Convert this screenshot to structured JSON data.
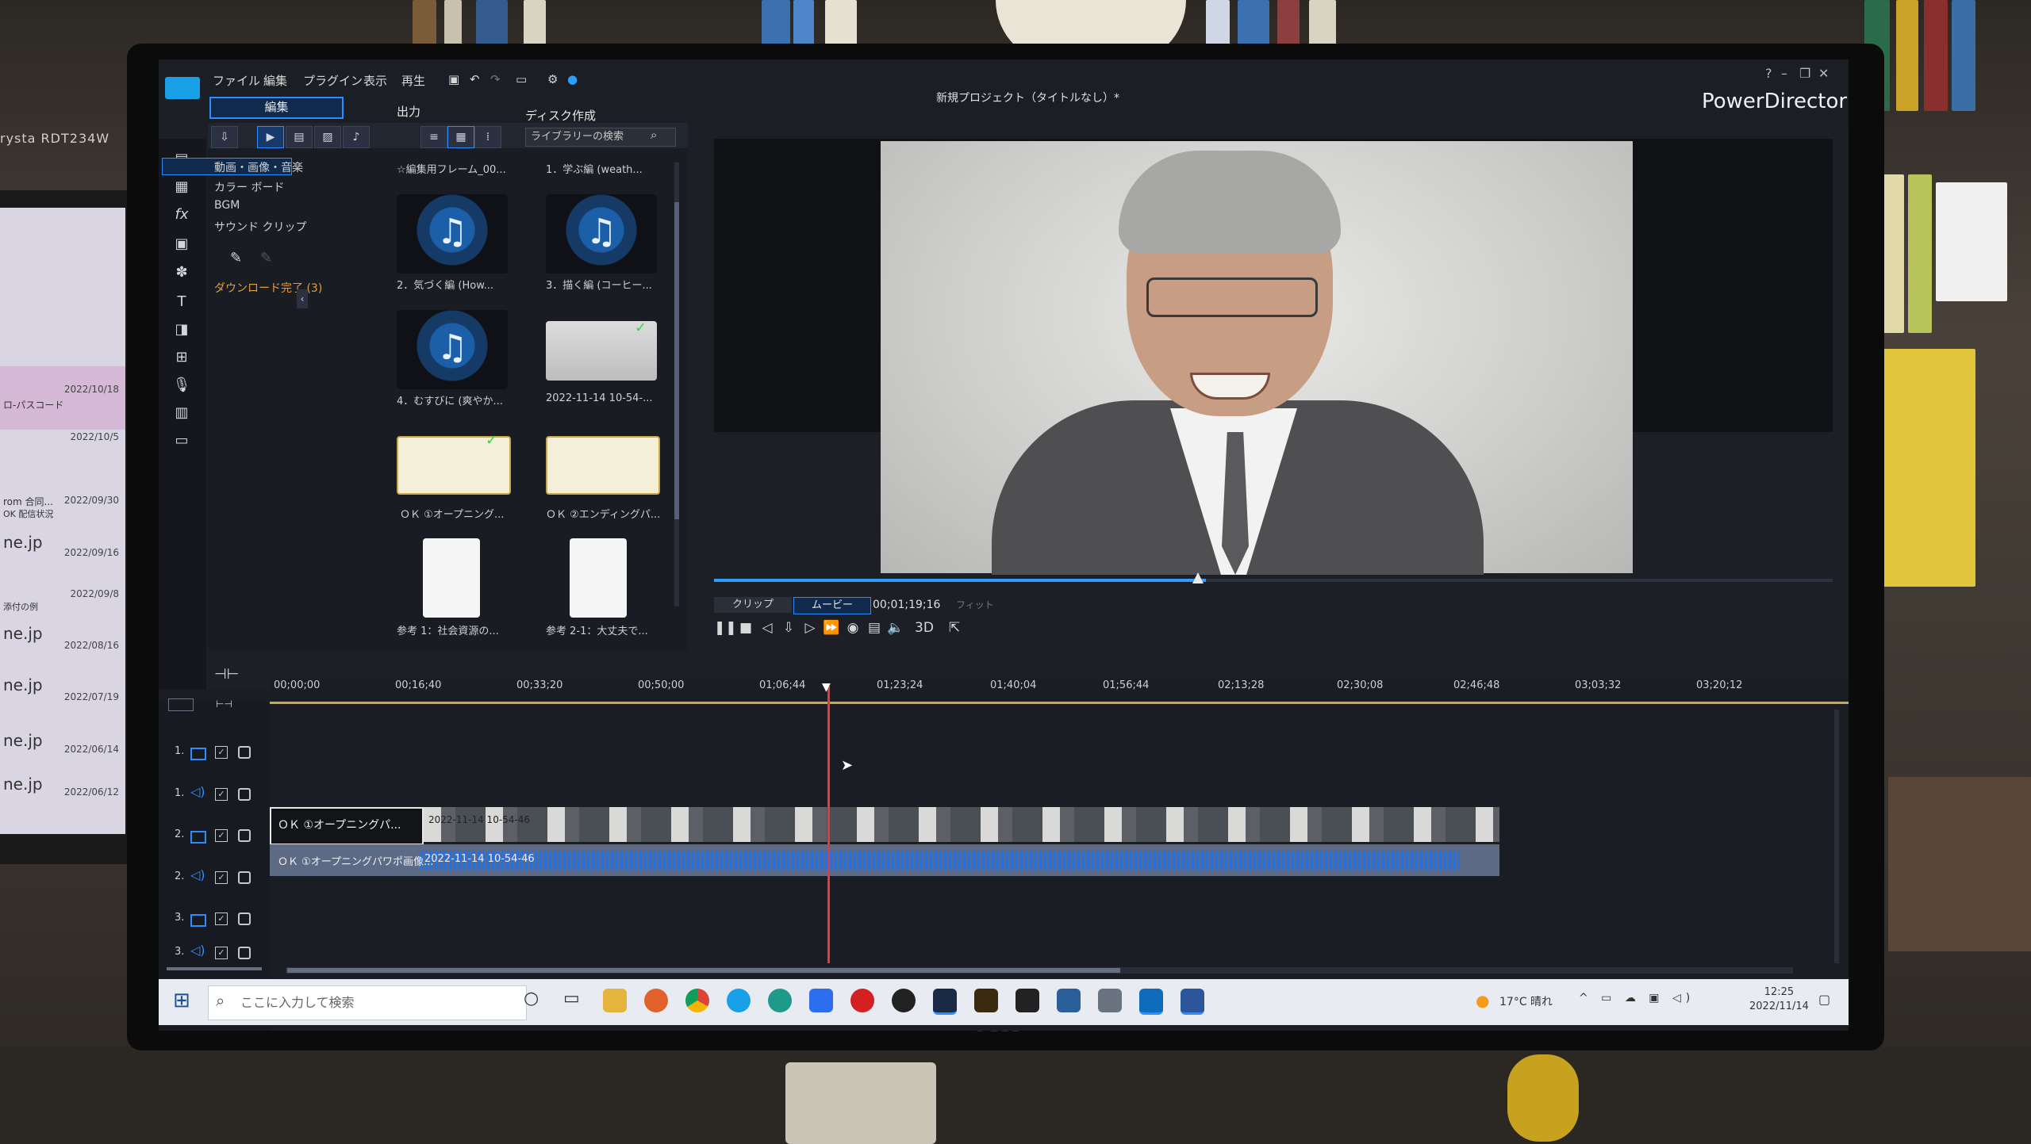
{
  "left_monitor": {
    "brand_label": "rysta RDT234W",
    "items": [
      {
        "text": "2022/10/18"
      },
      {
        "text": "ロ-パスコード"
      },
      {
        "text": "2022/10/5"
      },
      {
        "text": "rom 合同..."
      },
      {
        "text": "2022/09/30"
      },
      {
        "text": "OK 配信状況"
      },
      {
        "text": "ne.jp"
      },
      {
        "text": "2022/09/16"
      },
      {
        "text": "2022/09/8"
      },
      {
        "text": "添付の例"
      },
      {
        "text": "ne.jp"
      },
      {
        "text": "2022/08/16"
      },
      {
        "text": "ne.jp"
      },
      {
        "text": "2022/07/19"
      },
      {
        "text": "ne.jp"
      },
      {
        "text": "2022/06/14"
      },
      {
        "text": "ne.jp"
      },
      {
        "text": "2022/06/12"
      }
    ]
  },
  "app": {
    "menu": [
      "ファイル",
      "編集",
      "プラグイン",
      "表示",
      "再生"
    ],
    "tabs": [
      "編集",
      "出力",
      "ディスク作成"
    ],
    "project_title": "新規プロジェクト（タイトルなし）*",
    "brand": "PowerDirector",
    "search_placeholder": "ライブラリーの検索"
  },
  "library_tree": {
    "items": [
      "動画・画像・音楽",
      "カラー ボード",
      "BGM",
      "サウンド クリップ"
    ],
    "download": "ダウンロード完了 (3)"
  },
  "library_items": [
    {
      "label": "☆編集用フレーム_00...",
      "kind": "header"
    },
    {
      "label": "1．学ぶ編 (weath...",
      "kind": "header"
    },
    {
      "label": "2．気づく編 (How...",
      "kind": "audio"
    },
    {
      "label": "3．描く編 (コーヒー...",
      "kind": "audio"
    },
    {
      "label": "4．むすびに (爽やか...",
      "kind": "audio"
    },
    {
      "label": "2022-11-14 10-54-...",
      "kind": "photo"
    },
    {
      "label": "ＯＫ ①オープニング...",
      "kind": "slide"
    },
    {
      "label": "ＯＫ ②エンディングパ...",
      "kind": "slide"
    },
    {
      "label": "参考 1：社会資源の...",
      "kind": "doc"
    },
    {
      "label": "参考 2-1：大丈夫で...",
      "kind": "doc"
    }
  ],
  "preview": {
    "clip_label": "クリップ",
    "movie_label": "ムービー",
    "timecode": "00;01;19;16",
    "fit_label": "フィット",
    "mode_3d": "3D",
    "progress": 0.44
  },
  "timeline": {
    "ruler": [
      "00;00;00",
      "00;16;40",
      "00;33;20",
      "00;50;00",
      "01;06;44",
      "01;23;24",
      "01;40;04",
      "01;56;44",
      "02;13;28",
      "02;30;08",
      "02;46;48",
      "03;03;32",
      "03;20;12"
    ],
    "tracks": [
      "1.",
      "1.",
      "2.",
      "2.",
      "3.",
      "3."
    ],
    "clip_video_title": "ＯＫ ①オープニングパ...",
    "clip_video_name": "2022-11-14 10-54-46",
    "clip_audio_title": "ＯＫ ①オープニングパワポ画像...",
    "clip_audio_name": "2022-11-14 10-54-46"
  },
  "taskbar": {
    "search_placeholder": "ここに入力して検索",
    "weather": "17°C 晴れ",
    "time": "12:25",
    "date": "2022/11/14"
  },
  "colors": {
    "accent": "#2f8cff",
    "playhead": "#e33a3a",
    "ruler_line": "#c9a94a",
    "waveform": "#2a70d8"
  }
}
